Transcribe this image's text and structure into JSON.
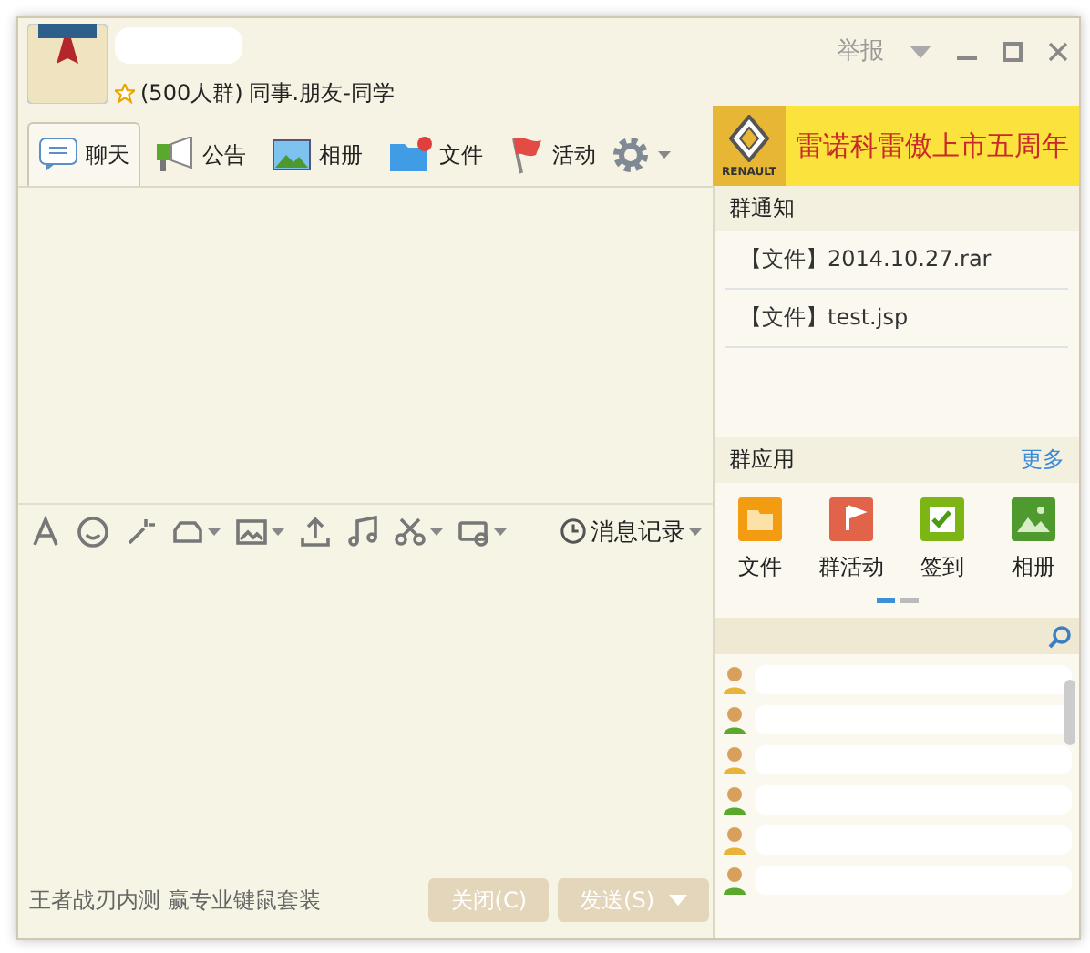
{
  "window": {
    "report": "举报"
  },
  "group": {
    "member_count": "(500人群)",
    "category": "同事.朋友-同学"
  },
  "tabs": [
    {
      "label": "聊天",
      "kind": "chat",
      "selected": true
    },
    {
      "label": "公告",
      "kind": "notice",
      "selected": false
    },
    {
      "label": "相册",
      "kind": "album",
      "selected": false
    },
    {
      "label": "文件",
      "kind": "file",
      "selected": false
    },
    {
      "label": "活动",
      "kind": "event",
      "selected": false
    }
  ],
  "ad_banner": {
    "brand": "RENAULT",
    "text": "雷诺科雷傲上市五周年"
  },
  "notices": {
    "title": "群通知",
    "items": [
      "【文件】2014.10.27.rar",
      "【文件】test.jsp"
    ]
  },
  "apps": {
    "title": "群应用",
    "more": "更多",
    "items": [
      {
        "label": "文件",
        "kind": "folder"
      },
      {
        "label": "群活动",
        "kind": "event"
      },
      {
        "label": "签到",
        "kind": "checkin"
      },
      {
        "label": "相册",
        "kind": "album"
      }
    ],
    "pages": [
      {
        "selected": true
      },
      {
        "selected": false
      }
    ]
  },
  "toolbar": {
    "history": "消息记录"
  },
  "footer": {
    "ad": "王者战刃内测 赢专业键鼠套装",
    "buttons": [
      {
        "label": "关闭(C)",
        "disabled": true
      },
      {
        "label": "发送(S)",
        "disabled": true
      }
    ]
  }
}
